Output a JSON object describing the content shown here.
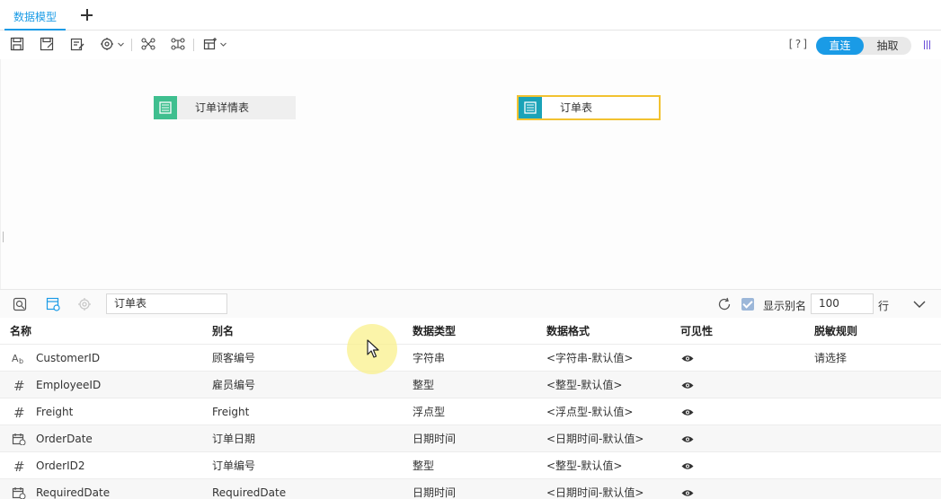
{
  "tabs": [
    {
      "label": "数据模型",
      "active": true
    }
  ],
  "toolbar": {
    "help_label": "[?]",
    "mode_direct": "直连",
    "mode_extract": "抽取",
    "accent": "#1a9be6"
  },
  "canvas": {
    "tables": [
      {
        "label": "订单详情表",
        "icon": "table-icon",
        "color": "#3fbf8f",
        "selected": false
      },
      {
        "label": "订单表",
        "icon": "table-icon",
        "color": "#1aa3b8",
        "selected": true
      }
    ]
  },
  "panel": {
    "table_name": "订单表",
    "show_alias_label": "显示别名",
    "show_alias_checked": true,
    "rows_value": "100",
    "rows_unit": "行"
  },
  "grid": {
    "headers": [
      "名称",
      "别名",
      "数据类型",
      "数据格式",
      "可见性",
      "脱敏规则"
    ],
    "rows": [
      {
        "type_icon": "text-type-icon",
        "name": "CustomerID",
        "alias": "顾客编号",
        "type": "字符串",
        "format": "<字符串-默认值>",
        "visible": true,
        "mask": "请选择"
      },
      {
        "type_icon": "number-type-icon",
        "name": "EmployeeID",
        "alias": "雇员编号",
        "type": "整型",
        "format": "<整型-默认值>",
        "visible": true,
        "mask": ""
      },
      {
        "type_icon": "number-type-icon",
        "name": "Freight",
        "alias": "Freight",
        "type": "浮点型",
        "format": "<浮点型-默认值>",
        "visible": true,
        "mask": ""
      },
      {
        "type_icon": "date-type-icon",
        "name": "OrderDate",
        "alias": "订单日期",
        "type": "日期时间",
        "format": "<日期时间-默认值>",
        "visible": true,
        "mask": ""
      },
      {
        "type_icon": "number-type-icon",
        "name": "OrderID2",
        "alias": "订单编号",
        "type": "整型",
        "format": "<整型-默认值>",
        "visible": true,
        "mask": ""
      },
      {
        "type_icon": "date-type-icon",
        "name": "RequiredDate",
        "alias": "RequiredDate",
        "type": "日期时间",
        "format": "<日期时间-默认值>",
        "visible": true,
        "mask": ""
      }
    ]
  }
}
